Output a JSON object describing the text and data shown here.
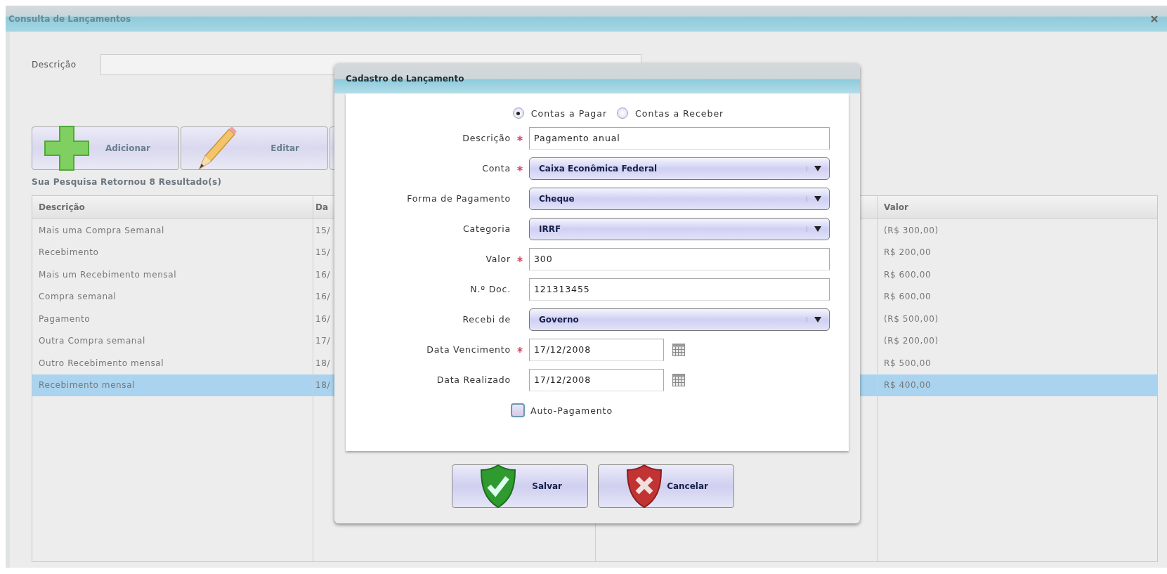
{
  "window": {
    "title": "Consulta de Lançamentos"
  },
  "search": {
    "label": "Descrição"
  },
  "toolbar": [
    {
      "label": "Adicionar",
      "kind": "add"
    },
    {
      "label": "Editar",
      "kind": "edit"
    },
    {
      "kind": "covered"
    }
  ],
  "result_text": "Sua Pesquisa Retornou 8 Resultado(s)",
  "table": {
    "columns": [
      "Descrição",
      "Da",
      "Valor"
    ],
    "rows": [
      {
        "description": "Mais uma Compra Semanal",
        "column_2": "15/",
        "value": "(R$ 300,00)",
        "selected": false
      },
      {
        "description": "Recebimento",
        "column_2": "15/",
        "value": "R$ 200,00",
        "selected": false
      },
      {
        "description": "Mais um Recebimento mensal",
        "column_2": "16/",
        "value": "R$ 600,00",
        "selected": false
      },
      {
        "description": "Compra semanal",
        "column_2": "16/",
        "value": "R$ 600,00",
        "selected": false
      },
      {
        "description": "Pagamento",
        "column_2": "16/",
        "value": "(R$ 500,00)",
        "selected": false
      },
      {
        "description": "Outra Compra semanal",
        "column_2": "17/",
        "value": "(R$ 200,00)",
        "selected": false
      },
      {
        "description": "Outro Recebimento mensal",
        "column_2": "18/",
        "value": "R$ 500,00",
        "selected": false
      },
      {
        "description": "Recebimento mensal",
        "column_2": "18/",
        "value": "R$ 400,00",
        "selected": true
      }
    ]
  },
  "dialog": {
    "title": "Cadastro de Lançamento",
    "radios": [
      {
        "label": "Contas a Pagar",
        "selected": true
      },
      {
        "label": "Contas a Receber",
        "selected": false
      }
    ],
    "fields": [
      {
        "kind": "text",
        "label": "Descrição",
        "required": true,
        "value": "Pagamento anual"
      },
      {
        "kind": "select",
        "label": "Conta",
        "required": true,
        "value": "Caixa Econômica Federal"
      },
      {
        "kind": "select",
        "label": "Forma de Pagamento",
        "required": false,
        "value": "Cheque"
      },
      {
        "kind": "select",
        "label": "Categoria",
        "required": false,
        "value": "IRRF"
      },
      {
        "kind": "text",
        "label": "Valor",
        "required": true,
        "value": "300"
      },
      {
        "kind": "text",
        "label": "N.º Doc.",
        "required": false,
        "value": "121313455"
      },
      {
        "kind": "select",
        "label": "Recebi de",
        "required": false,
        "value": "Governo"
      },
      {
        "kind": "date",
        "label": "Data Vencimento",
        "required": true,
        "value": "17/12/2008"
      },
      {
        "kind": "date",
        "label": "Data Realizado",
        "required": false,
        "value": "17/12/2008"
      }
    ],
    "checkbox": {
      "label": "Auto-Pagamento",
      "checked": false
    },
    "buttons": [
      {
        "label": "Salvar",
        "kind": "save"
      },
      {
        "label": "Cancelar",
        "kind": "cancel"
      }
    ]
  }
}
